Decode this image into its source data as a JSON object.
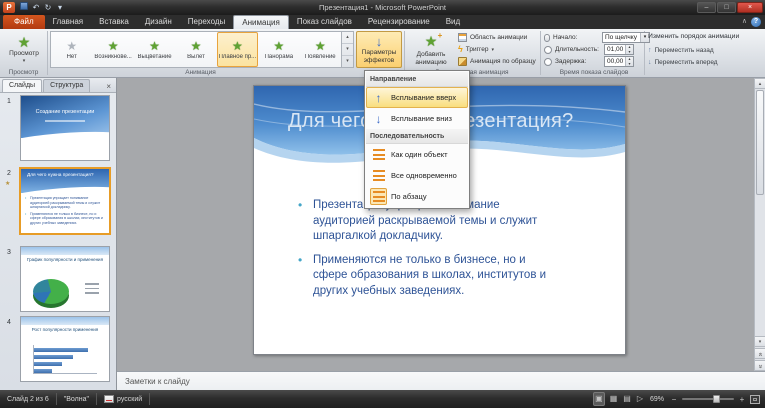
{
  "titlebar": {
    "title": "Презентация1 - Microsoft PowerPoint"
  },
  "tabs": [
    {
      "label": "Файл"
    },
    {
      "label": "Главная"
    },
    {
      "label": "Вставка"
    },
    {
      "label": "Дизайн"
    },
    {
      "label": "Переходы"
    },
    {
      "label": "Анимация"
    },
    {
      "label": "Показ слайдов"
    },
    {
      "label": "Рецензирование"
    },
    {
      "label": "Вид"
    }
  ],
  "ribbon": {
    "preview": {
      "label": "Просмотр",
      "group": "Просмотр"
    },
    "gallery": [
      {
        "label": "Нет"
      },
      {
        "label": "Возникнове..."
      },
      {
        "label": "Выцветание"
      },
      {
        "label": "Вылет"
      },
      {
        "label": "Плавное пр..."
      },
      {
        "label": "Панорама"
      },
      {
        "label": "Появление"
      }
    ],
    "gallery_group": "Анимация",
    "effect_options": {
      "line1": "Параметры",
      "line2": "эффектов"
    },
    "add_animation": {
      "line1": "Добавить",
      "line2": "анимацию"
    },
    "advanced": {
      "pane": "Область анимации",
      "trigger": "Триггер",
      "painter": "Анимация по образцу",
      "group": "Расширенная анимация"
    },
    "timing": {
      "start_label": "Начало:",
      "start_value": "По щелчку",
      "duration_label": "Длительность:",
      "duration_value": "01,00",
      "delay_label": "Задержка:",
      "delay_value": "00,00",
      "group": "Время показа слайдов",
      "reorder_title": "Изменить порядок анимации",
      "move_earlier": "Переместить назад",
      "move_later": "Переместить вперед"
    }
  },
  "menu": {
    "direction_header": "Направление",
    "sequence_header": "Последовательность",
    "items": [
      {
        "label": "Всплывание вверх"
      },
      {
        "label": "Всплывание вниз"
      },
      {
        "label": "Как один объект"
      },
      {
        "label": "Все одновременно"
      },
      {
        "label": "По абзацу"
      }
    ]
  },
  "panel": {
    "tab_slides": "Слайды",
    "tab_outline": "Структура",
    "thumbs": [
      {
        "num": "1",
        "title": "Создание презентации"
      },
      {
        "num": "2",
        "title": "Для чего нужна презентация?"
      },
      {
        "num": "3",
        "title": "График популярности и применения"
      },
      {
        "num": "4",
        "title": "Рост популярности применения"
      }
    ]
  },
  "slide": {
    "title": "Для чего нужна презентация?",
    "bullets": [
      "Презентация упрощает понимание аудиторией раскрываемой темы и служит шпаргалкой докладчику.",
      "Применяются не только в бизнесе, но и сфере образования в школах, институтов и других учебных заведениях."
    ]
  },
  "notes": {
    "label": "Заметки к слайду"
  },
  "status": {
    "slide_info": "Слайд 2 из 6",
    "theme": "\"Волна\"",
    "language": "русский",
    "zoom": "69%"
  },
  "icons": {
    "logo": "P",
    "undo": "↶",
    "redo": "↻",
    "dropdown": "▾",
    "minimize": "–",
    "maximize": "□",
    "close": "×",
    "chevron_up": "∧",
    "help": "?",
    "star": "★",
    "plus": "+",
    "lightning": "ϟ",
    "up_arrow": "↑",
    "down_arrow": "↓",
    "tri_up": "▴",
    "tri_down": "▾",
    "prev": "«",
    "next": "»",
    "view_normal": "▣",
    "view_sorter": "▦",
    "view_reading": "▤",
    "view_show": "▷",
    "minus": "−",
    "zoom_plus": "+"
  },
  "colors": {
    "selection_orange": "#E8A33D",
    "star_green": "#5FA233",
    "arrow_blue": "#3E6CC8"
  }
}
